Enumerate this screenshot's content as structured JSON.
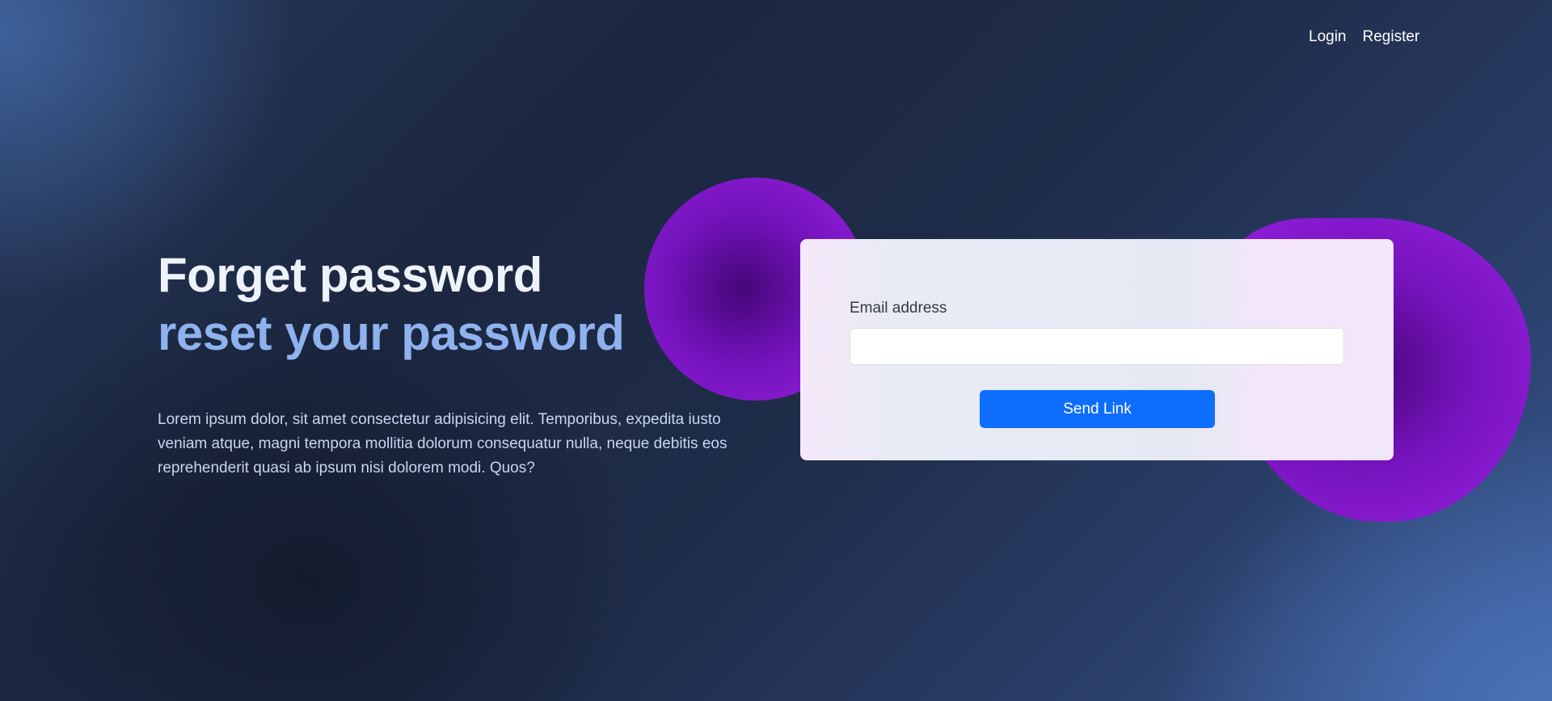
{
  "nav": {
    "login_label": "Login",
    "register_label": "Register"
  },
  "hero": {
    "title_line1": "Forget password",
    "title_line2": "reset your password",
    "description": "Lorem ipsum dolor, sit amet consectetur adipisicing elit. Temporibus, expedita iusto veniam atque, magni tempora mollitia dolorum consequatur nulla, neque debitis eos reprehenderit quasi ab ipsum nisi dolorem modi. Quos?"
  },
  "form": {
    "email_label": "Email address",
    "email_value": "",
    "submit_label": "Send Link"
  },
  "colors": {
    "accent_button": "#0d6efd",
    "title_highlight": "#8eb2ee",
    "blob_purple": "#9722df"
  }
}
